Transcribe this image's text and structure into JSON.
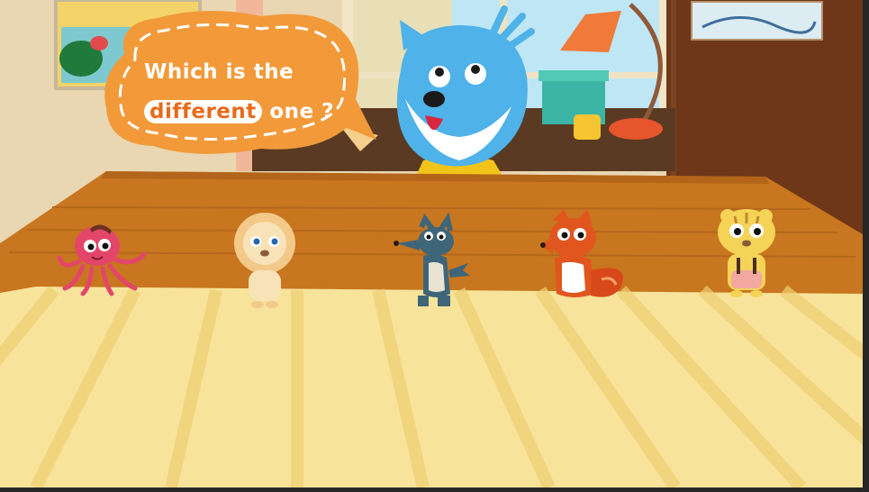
{
  "question": {
    "line1": "Which is the",
    "highlight": "different",
    "rest": "one",
    "mark": "?"
  },
  "characters": [
    {
      "name": "octopus",
      "color": "#e3466a"
    },
    {
      "name": "lion",
      "color": "#f3c98a"
    },
    {
      "name": "wolf",
      "color": "#3f6678"
    },
    {
      "name": "fox",
      "color": "#e1561f"
    },
    {
      "name": "tiger",
      "color": "#f4d357"
    }
  ],
  "colors": {
    "bubble": "#f29a3a",
    "table_top": "#c8761f",
    "mat": "#f7e39a",
    "host": "#4fb2e8"
  }
}
